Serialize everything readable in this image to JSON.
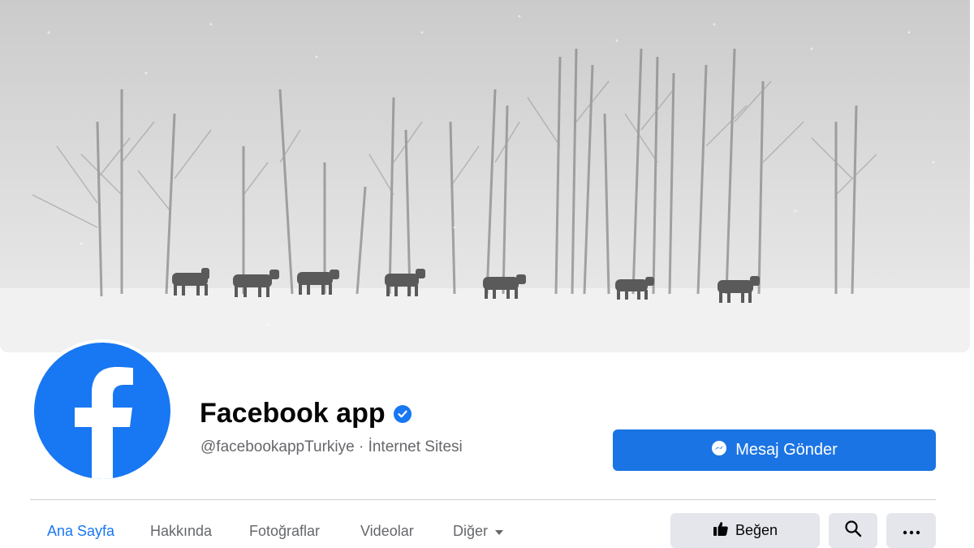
{
  "page": {
    "name": "Facebook app",
    "handle": "@facebookappTurkiye",
    "separator": "·",
    "category": "İnternet Sitesi"
  },
  "actions": {
    "message_label": "Mesaj Gönder",
    "like_label": "Beğen"
  },
  "tabs": [
    {
      "label": "Ana Sayfa",
      "active": true
    },
    {
      "label": "Hakkında",
      "active": false
    },
    {
      "label": "Fotoğraflar",
      "active": false
    },
    {
      "label": "Videolar",
      "active": false
    },
    {
      "label": "Diğer",
      "active": false
    }
  ],
  "icons": {
    "verified": "verified-badge-icon",
    "messenger": "messenger-icon",
    "like": "thumbs-up-icon",
    "search": "search-icon",
    "more": "ellipsis-icon",
    "dropdown": "caret-down-icon"
  },
  "colors": {
    "brand": "#1877f2",
    "button_primary": "#1b74e4",
    "button_secondary": "#e4e6eb",
    "text_primary": "#050505",
    "text_secondary": "#65676b"
  }
}
